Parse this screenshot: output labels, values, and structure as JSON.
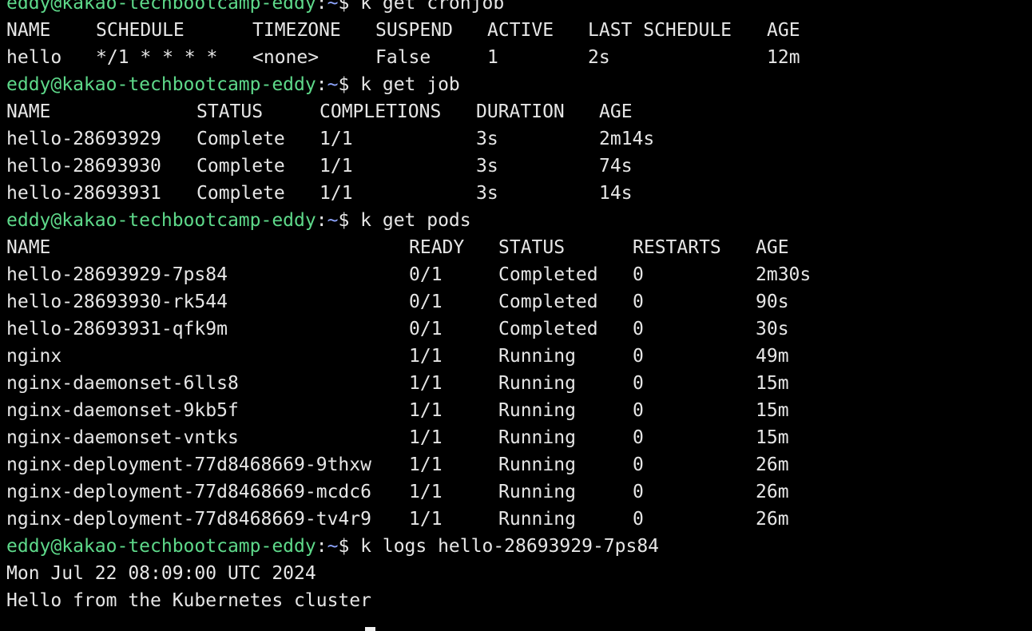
{
  "prompt": {
    "user_host": "eddy@kakao-techbootcamp-eddy",
    "separator": ":",
    "path": "~",
    "symbol": "$ "
  },
  "top_partial_line": "eddy@kakao-techbootcamp-eddy:~$ k get cronjob",
  "commands": {
    "cronjob": "k get cronjob",
    "job": "k get job",
    "pods": "k get pods",
    "logs": "k logs hello-28693929-7ps84"
  },
  "cronjob_table": {
    "headers": [
      "NAME",
      "SCHEDULE",
      "TIMEZONE",
      "SUSPEND",
      "ACTIVE",
      "LAST SCHEDULE",
      "AGE"
    ],
    "rows": [
      [
        "hello",
        "*/1 * * * *",
        "<none>",
        "False",
        "1",
        "2s",
        "12m"
      ]
    ]
  },
  "job_table": {
    "headers": [
      "NAME",
      "STATUS",
      "COMPLETIONS",
      "DURATION",
      "AGE"
    ],
    "rows": [
      [
        "hello-28693929",
        "Complete",
        "1/1",
        "3s",
        "2m14s"
      ],
      [
        "hello-28693930",
        "Complete",
        "1/1",
        "3s",
        "74s"
      ],
      [
        "hello-28693931",
        "Complete",
        "1/1",
        "3s",
        "14s"
      ]
    ]
  },
  "pods_table": {
    "headers": [
      "NAME",
      "READY",
      "STATUS",
      "RESTARTS",
      "AGE"
    ],
    "rows": [
      [
        "hello-28693929-7ps84",
        "0/1",
        "Completed",
        "0",
        "2m30s"
      ],
      [
        "hello-28693930-rk544",
        "0/1",
        "Completed",
        "0",
        "90s"
      ],
      [
        "hello-28693931-qfk9m",
        "0/1",
        "Completed",
        "0",
        "30s"
      ],
      [
        "nginx",
        "1/1",
        "Running",
        "0",
        "49m"
      ],
      [
        "nginx-daemonset-6lls8",
        "1/1",
        "Running",
        "0",
        "15m"
      ],
      [
        "nginx-daemonset-9kb5f",
        "1/1",
        "Running",
        "0",
        "15m"
      ],
      [
        "nginx-daemonset-vntks",
        "1/1",
        "Running",
        "0",
        "15m"
      ],
      [
        "nginx-deployment-77d8468669-9thxw",
        "1/1",
        "Running",
        "0",
        "26m"
      ],
      [
        "nginx-deployment-77d8468669-mcdc6",
        "1/1",
        "Running",
        "0",
        "26m"
      ],
      [
        "nginx-deployment-77d8468669-tv4r9",
        "1/1",
        "Running",
        "0",
        "26m"
      ]
    ]
  },
  "log_output": [
    "Mon Jul 22 08:09:00 UTC 2024",
    "Hello from the Kubernetes cluster"
  ],
  "colors": {
    "background": "#000000",
    "text": "#e6e6e6",
    "prompt_user": "#5ed98a",
    "prompt_path": "#8fa6ff",
    "cursor": "#f0f0f0"
  }
}
